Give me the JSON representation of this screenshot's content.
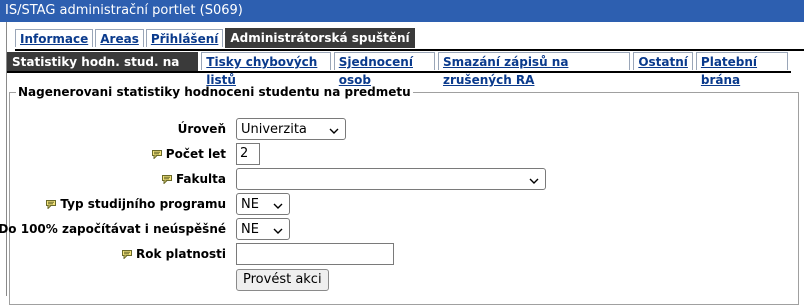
{
  "window": {
    "title": "IS/STAG administrační portlet (S069)"
  },
  "tabs_primary": [
    {
      "label": "Informace",
      "active": false
    },
    {
      "label": "Areas",
      "active": false
    },
    {
      "label": "Přihlášení",
      "active": false
    },
    {
      "label": "Administrátorská spuštění",
      "active": true
    }
  ],
  "tabs_secondary": [
    {
      "label": "Statistiky hodn. stud. na předm.",
      "active": true
    },
    {
      "label": "Tisky chybových listů",
      "active": false
    },
    {
      "label": "Sjednocení osob",
      "active": false
    },
    {
      "label": "Smazání zápisů na zrušených RA",
      "active": false
    },
    {
      "label": "Ostatní",
      "active": false
    },
    {
      "label": "Platební brána",
      "active": false
    }
  ],
  "form": {
    "legend": "Nagenerovani statistiky hodnoceni studentu na predmetu",
    "fields": {
      "uroven": {
        "label": "Úroveň",
        "value": "Univerzita"
      },
      "pocet_let": {
        "label": "Počet let",
        "value": "2"
      },
      "fakulta": {
        "label": "Fakulta",
        "value": ""
      },
      "typ_programu": {
        "label": "Typ studijního programu",
        "value": "NE"
      },
      "do100": {
        "label": "Do 100% započítávat i neúspěšné",
        "value": "NE"
      },
      "rok_platnosti": {
        "label": "Rok platnosti",
        "value": ""
      }
    },
    "submit_label": "Provést akci"
  },
  "colors": {
    "titlebar": "#2d5fb0",
    "active_tab": "#3a3a3a",
    "link": "#0a3a8c"
  }
}
